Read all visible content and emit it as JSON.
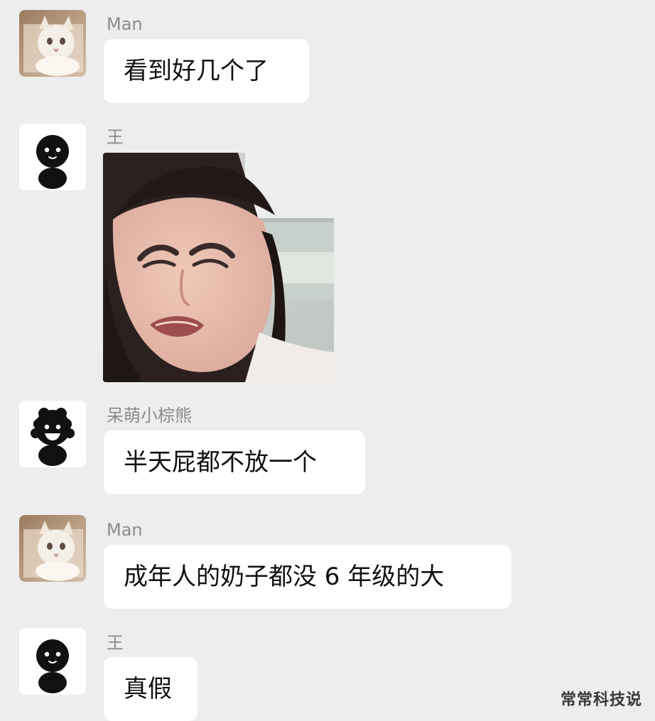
{
  "messages": [
    {
      "sender": "Man",
      "text": "看到好几个了"
    },
    {
      "sender": "王",
      "type": "image"
    },
    {
      "sender": "呆萌小棕熊",
      "text": "半天屁都不放一个"
    },
    {
      "sender": "Man",
      "text": "成年人的奶子都没 6 年级的大"
    },
    {
      "sender": "王",
      "text": "真假"
    }
  ],
  "watermark": "常常科技说",
  "colors": {
    "background": "#ededed",
    "bubble": "#ffffff",
    "name": "#8b8b8b",
    "text": "#111111"
  }
}
